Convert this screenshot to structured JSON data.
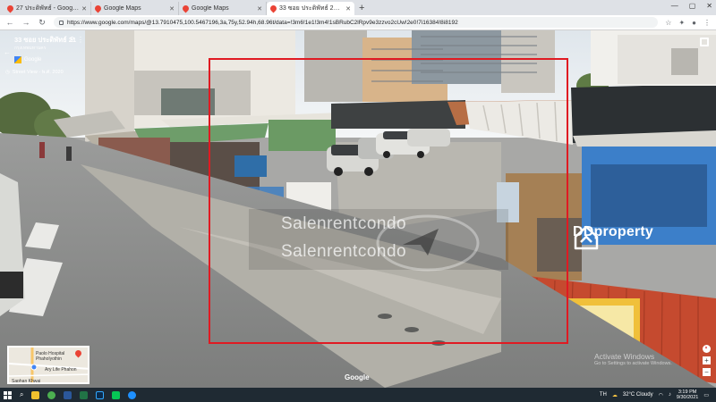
{
  "browser": {
    "tabs": [
      {
        "title": "27 ประดิพัทธ์ - Google Maps",
        "active": false
      },
      {
        "title": "Google Maps",
        "active": false
      },
      {
        "title": "Google Maps",
        "active": false
      },
      {
        "title": "33 ซอย ประดิพัทธ์ 21 - Google Maps",
        "active": true
      }
    ],
    "new_tab_label": "+",
    "window_controls": {
      "minimize": "—",
      "maximize": "▢",
      "close": "✕"
    },
    "nav": {
      "back": "←",
      "forward": "→",
      "reload": "↻"
    },
    "url": "https://www.google.com/maps/@13.7910475,100.5467196,3a,75y,52.94h,68.96t/data=!3m6!1e1!3m4!1sBRubC2lRpv9e3zzvo2cUw!2e0!7i16384!8i8192",
    "toolbar_icons": [
      "star-icon",
      "extensions-icon",
      "profile-icon",
      "menu-icon"
    ]
  },
  "streetview": {
    "title": "33 ซอย ประดิพัทธ์ 21",
    "subtitle": "กรุงเทพมหานคร",
    "provider": "Google",
    "capture": "Street View - พ.ศ. 2020",
    "back_glyph": "←",
    "more_glyph": "⋮",
    "google_watermark": "Google"
  },
  "watermark": {
    "line1": "Salenrentcondo",
    "line2": "Salenrentcondo"
  },
  "brand_logo": {
    "text": "DDproperty"
  },
  "activation": {
    "title": "Activate Windows",
    "subtitle": "Go to Settings to activate Windows."
  },
  "minimap": {
    "labels": [
      "Paolo Hospital",
      "Phaholyothin",
      "Ary Life Phahon",
      "Saphan Khwai"
    ]
  },
  "map_controls": {
    "zoom_in": "+",
    "zoom_out": "−"
  },
  "taskbar": {
    "search_glyph": "⌕",
    "apps": [
      {
        "name": "file-explorer-icon",
        "color": "#f2c12e"
      },
      {
        "name": "chrome-icon",
        "color": "#4caf50"
      },
      {
        "name": "word-icon",
        "color": "#2b579a"
      },
      {
        "name": "excel-icon",
        "color": "#217346"
      },
      {
        "name": "photoshop-icon",
        "color": "#31a8ff"
      },
      {
        "name": "line-icon",
        "color": "#06c755"
      },
      {
        "name": "edge-icon",
        "color": "#1e90ff"
      }
    ],
    "tray": {
      "lang": "TH",
      "weather": "32°C  Cloudy",
      "time": "3:19 PM",
      "date": "9/30/2021"
    }
  },
  "colors": {
    "highlight_box": "#e01a22",
    "taskbar_bg": "#1f2a33",
    "tab_strip": "#dee1e6"
  }
}
